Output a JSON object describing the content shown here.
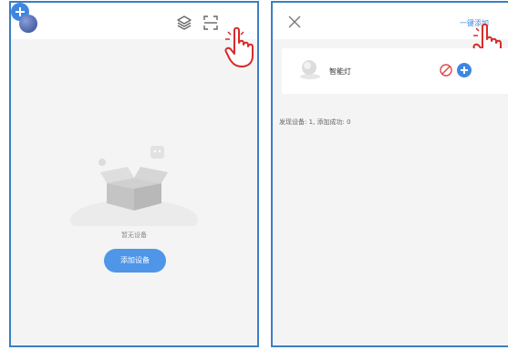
{
  "left": {
    "empty_text": "暂无设备",
    "add_device_label": "添加设备"
  },
  "right": {
    "one_key_add_label": "一键添加",
    "device_name": "智能灯",
    "status": "发现设备: 1, 添加成功: 0"
  },
  "icons": {
    "avatar": "avatar",
    "layers": "layers-icon",
    "scan": "scan-icon",
    "add": "add-circle-icon",
    "close": "close-icon",
    "lamp": "lamp-icon",
    "block": "block-icon",
    "hand": "pointing-hand-icon",
    "empty_box": "empty-box-illustration"
  },
  "colors": {
    "accent": "#3f86e0",
    "button": "#4f96e8",
    "block_red": "#e04848",
    "panel_border": "#3b7fc4"
  }
}
